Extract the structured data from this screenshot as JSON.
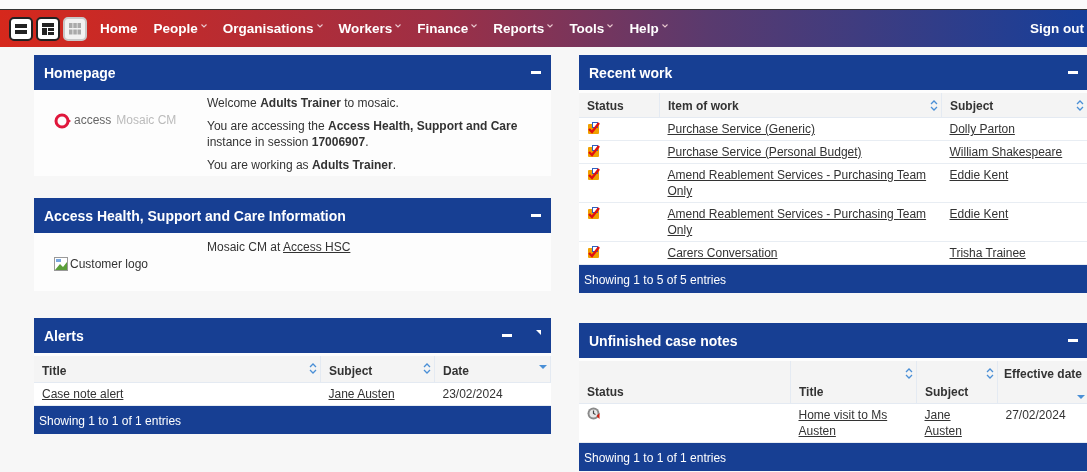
{
  "navbar": {
    "layout_buttons": [
      {
        "kind": "rows",
        "disabled": false
      },
      {
        "kind": "panels",
        "disabled": false
      },
      {
        "kind": "grid",
        "disabled": true
      }
    ],
    "menu": [
      {
        "label": "Home",
        "has_menu": false
      },
      {
        "label": "People",
        "has_menu": true
      },
      {
        "label": "Organisations",
        "has_menu": true
      },
      {
        "label": "Workers",
        "has_menu": true
      },
      {
        "label": "Finance",
        "has_menu": true
      },
      {
        "label": "Reports",
        "has_menu": true
      },
      {
        "label": "Tools",
        "has_menu": true
      },
      {
        "label": "Help",
        "has_menu": true
      }
    ],
    "sign_out": "Sign out"
  },
  "left_column": [
    {
      "kind": "homepage",
      "title": "Homepage",
      "controls": [
        {
          "kind": "collapse"
        }
      ],
      "logo": {
        "brand": "access",
        "product": "Mosaic CM"
      },
      "paragraphs": [
        "Welcome **Adults Trainer** to mosaic.",
        "You are accessing the **Access Health, Support and Care** instance in session **17006907**.",
        "You are working as **Adults Trainer**."
      ]
    },
    {
      "kind": "info",
      "title": "Access Health, Support and Care Information",
      "controls": [
        {
          "kind": "collapse"
        }
      ],
      "image_alt": "Customer logo",
      "text": "Mosaic CM at",
      "link": "Access HSC"
    },
    {
      "kind": "table",
      "title": "Alerts",
      "controls": [
        {
          "kind": "collapse"
        },
        {
          "kind": "corner"
        }
      ],
      "columns": [
        {
          "label": "Title",
          "kind": "link",
          "sortable": true,
          "sorted": false
        },
        {
          "label": "Subject",
          "kind": "link",
          "sortable": true,
          "sorted": false
        },
        {
          "label": "Date",
          "kind": "text",
          "sortable": false,
          "sorted": true
        }
      ],
      "rows": [
        {
          "cells": [
            "Case note alert",
            "Jane Austen",
            "23/02/2024"
          ]
        }
      ],
      "footer": "Showing 1 to 1 of 1 entries"
    }
  ],
  "right_column": [
    {
      "kind": "table",
      "title": "Recent work",
      "controls": [
        {
          "kind": "collapse"
        }
      ],
      "columns": [
        {
          "label": "Status",
          "kind": "status",
          "sortable": false,
          "sorted": false
        },
        {
          "label": "Item of work",
          "kind": "link",
          "sortable": true,
          "sorted": false
        },
        {
          "label": "Subject",
          "kind": "link",
          "sortable": true,
          "sorted": false
        }
      ],
      "rows": [
        {
          "kind": "task",
          "cells": [
            "",
            "Purchase Service (Generic)",
            "Dolly Parton"
          ]
        },
        {
          "kind": "task",
          "cells": [
            "",
            "Purchase Service (Personal Budget)",
            "William Shakespeare"
          ]
        },
        {
          "kind": "task",
          "cells": [
            "",
            "Amend Reablement Services - Purchasing Team Only",
            "Eddie Kent"
          ]
        },
        {
          "kind": "task",
          "cells": [
            "",
            "Amend Reablement Services - Purchasing Team Only",
            "Eddie Kent"
          ]
        },
        {
          "kind": "task",
          "cells": [
            "",
            "Carers Conversation",
            "Trisha Trainee"
          ]
        }
      ],
      "footer": "Showing 1 to 5 of 5 entries"
    },
    {
      "kind": "table",
      "title": "Unfinished case notes",
      "controls": [
        {
          "kind": "collapse"
        }
      ],
      "columns": [
        {
          "label": "Status",
          "kind": "status",
          "sortable": false,
          "sorted": false
        },
        {
          "label": "Title",
          "kind": "link",
          "sortable": true,
          "sorted": false
        },
        {
          "label": "Subject",
          "kind": "link",
          "sortable": true,
          "sorted": false
        },
        {
          "label": "Effective date",
          "kind": "text",
          "sortable": false,
          "sorted": true
        }
      ],
      "rows": [
        {
          "kind": "draft",
          "cells": [
            "",
            "Home visit to Ms Austen",
            "Jane Austen",
            "27/02/2024"
          ]
        }
      ],
      "footer": "Showing 1 to 1 of 1 entries"
    }
  ]
}
